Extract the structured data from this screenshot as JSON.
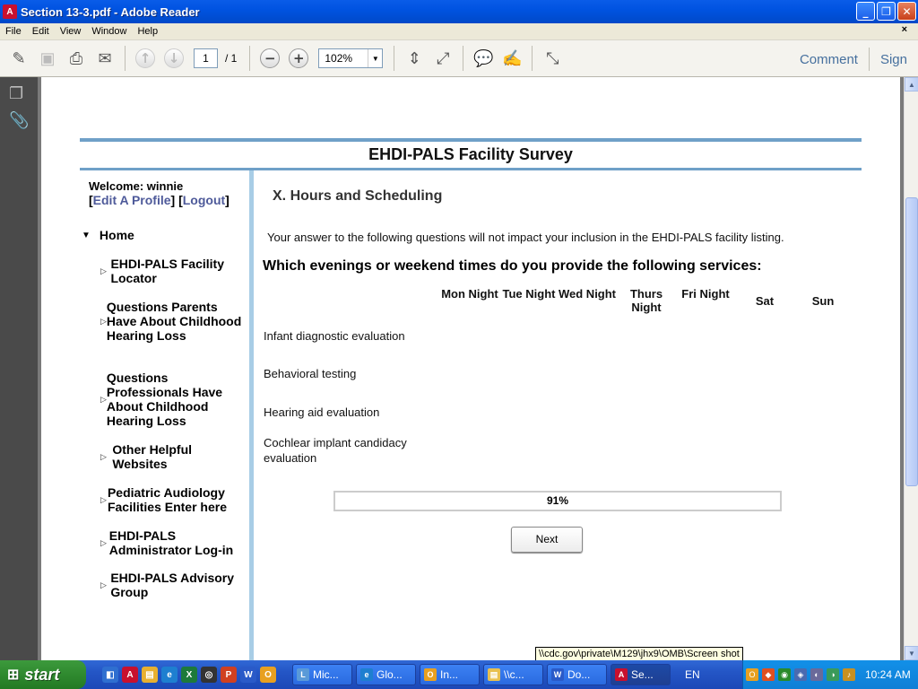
{
  "window": {
    "title": "Section 13-3.pdf - Adobe Reader",
    "min": "_",
    "max": "❐",
    "close": "✕"
  },
  "menu": {
    "items": [
      "File",
      "Edit",
      "View",
      "Window",
      "Help"
    ],
    "close_doc": "×"
  },
  "toolbar": {
    "page_current": "1",
    "page_total": "/ 1",
    "zoom": "102%",
    "comment": "Comment",
    "sign": "Sign"
  },
  "survey": {
    "title": "EHDI-PALS Facility Survey",
    "welcome": "Welcome: winnie",
    "edit_profile": "Edit A Profile",
    "logout": "Logout",
    "nav_home": "Home",
    "nav_items": [
      "EHDI-PALS Facility Locator",
      "Questions Parents Have About Childhood Hearing Loss",
      "Questions Professionals Have About Childhood Hearing Loss",
      "Other Helpful Websites",
      "Pediatric Audiology Facilities Enter here",
      "EHDI-PALS Administrator Log-in",
      "EHDI-PALS Advisory Group"
    ],
    "section_heading": "X. Hours and Scheduling",
    "intro": "Your answer to the following questions will not impact your inclusion in the EHDI-PALS facility listing.",
    "question": "Which evenings or weekend times do you provide the following services:",
    "columns": [
      "Mon Night",
      "Tue Night",
      "Wed Night",
      "Thurs Night",
      "Fri Night",
      "Sat",
      "Sun"
    ],
    "rows": [
      "Infant diagnostic evaluation",
      "Behavioral testing",
      "Hearing aid evaluation",
      "Cochlear implant candidacy evaluation"
    ],
    "progress_label": "91%",
    "progress_value": 0.91,
    "next": "Next"
  },
  "tooltip": "\\\\cdc.gov\\private\\M129\\jhx9\\OMB\\Screen shot",
  "taskbar": {
    "start": "start",
    "tasks": [
      "Mic...",
      "Glo...",
      "In...",
      "\\\\c...",
      "Do...",
      "Se..."
    ],
    "lang": "EN",
    "clock": "10:24 AM"
  }
}
